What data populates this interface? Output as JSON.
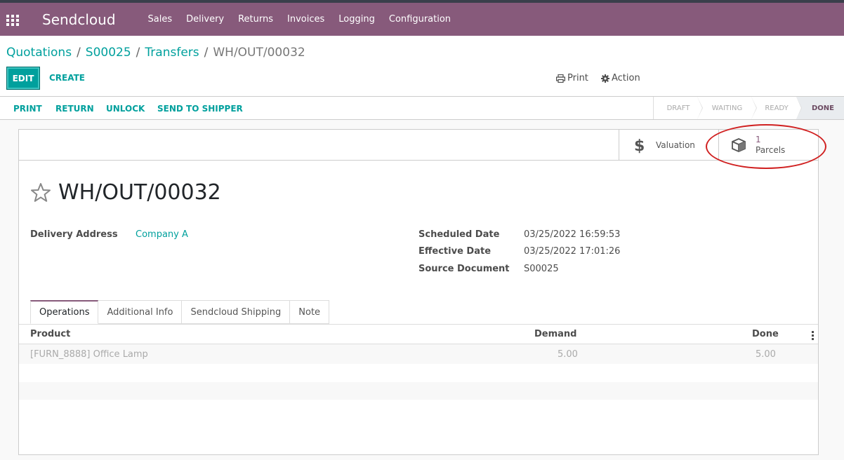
{
  "app": {
    "brand": "Sendcloud"
  },
  "menu": [
    "Sales",
    "Delivery",
    "Returns",
    "Invoices",
    "Logging",
    "Configuration"
  ],
  "breadcrumb": {
    "items": [
      "Quotations",
      "S00025",
      "Transfers"
    ],
    "current": "WH/OUT/00032",
    "separator": "/"
  },
  "controls": {
    "edit_label": "EDIT",
    "create_label": "CREATE",
    "print_label": "Print",
    "action_label": "Action"
  },
  "statusbar": {
    "buttons": [
      "PRINT",
      "RETURN",
      "UNLOCK",
      "SEND TO SHIPPER"
    ],
    "stages": [
      "DRAFT",
      "WAITING",
      "READY",
      "DONE"
    ],
    "active_stage": "DONE"
  },
  "smart_buttons": {
    "valuation_label": "Valuation",
    "parcels_count": "1",
    "parcels_label": "Parcels"
  },
  "record": {
    "title": "WH/OUT/00032",
    "delivery_address_label": "Delivery Address",
    "delivery_address_value": "Company A",
    "scheduled_date_label": "Scheduled Date",
    "scheduled_date_value": "03/25/2022 16:59:53",
    "effective_date_label": "Effective Date",
    "effective_date_value": "03/25/2022 17:01:26",
    "source_document_label": "Source Document",
    "source_document_value": "S00025"
  },
  "tabs": [
    "Operations",
    "Additional Info",
    "Sendcloud Shipping",
    "Note"
  ],
  "table": {
    "columns": {
      "product": "Product",
      "demand": "Demand",
      "done": "Done"
    },
    "rows": [
      {
        "product": "[FURN_8888] Office Lamp",
        "demand": "5.00",
        "done": "5.00"
      }
    ]
  },
  "colors": {
    "brand": "#875a7b",
    "accent": "#00a09d",
    "highlight": "#d02020"
  }
}
